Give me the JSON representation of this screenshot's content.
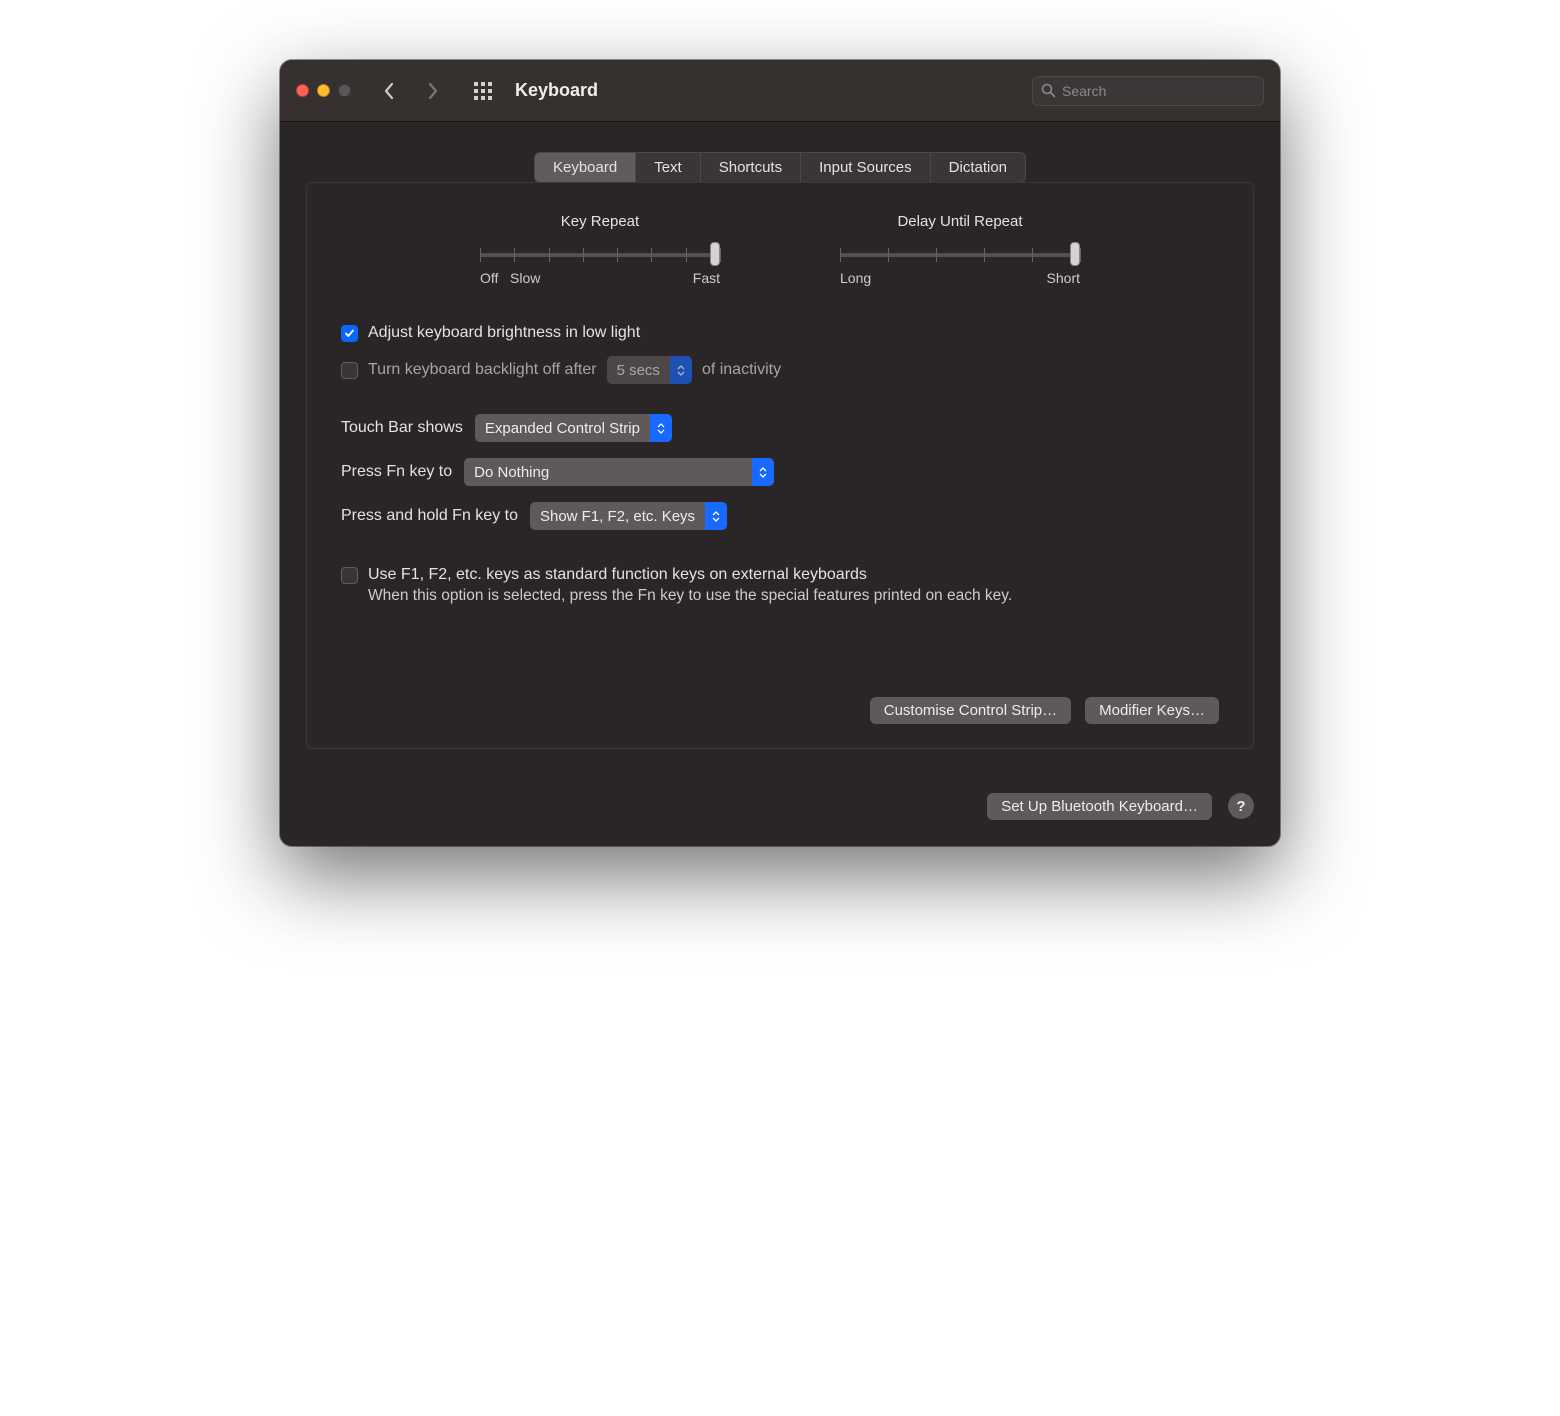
{
  "window": {
    "title": "Keyboard",
    "search_placeholder": "Search"
  },
  "tabs": [
    "Keyboard",
    "Text",
    "Shortcuts",
    "Input Sources",
    "Dictation"
  ],
  "sliders": {
    "key_repeat": {
      "title": "Key Repeat",
      "left_label": "Off",
      "left_label2": "Slow",
      "right_label": "Fast"
    },
    "delay": {
      "title": "Delay Until Repeat",
      "left_label": "Long",
      "right_label": "Short"
    }
  },
  "options": {
    "adjust_brightness": "Adjust keyboard brightness in low light",
    "backlight_off_prefix": "Turn keyboard backlight off after",
    "backlight_off_value": "5 secs",
    "backlight_off_suffix": "of inactivity",
    "touchbar_label": "Touch Bar shows",
    "touchbar_value": "Expanded Control Strip",
    "press_fn_label": "Press Fn key to",
    "press_fn_value": "Do Nothing",
    "hold_fn_label": "Press and hold Fn key to",
    "hold_fn_value": "Show F1, F2, etc. Keys",
    "use_fkeys_label": "Use F1, F2, etc. keys as standard function keys on external keyboards",
    "use_fkeys_desc": "When this option is selected, press the Fn key to use the special features printed on each key."
  },
  "buttons": {
    "customise_control_strip": "Customise Control Strip…",
    "modifier_keys": "Modifier Keys…",
    "setup_bluetooth": "Set Up Bluetooth Keyboard…",
    "help": "?"
  }
}
